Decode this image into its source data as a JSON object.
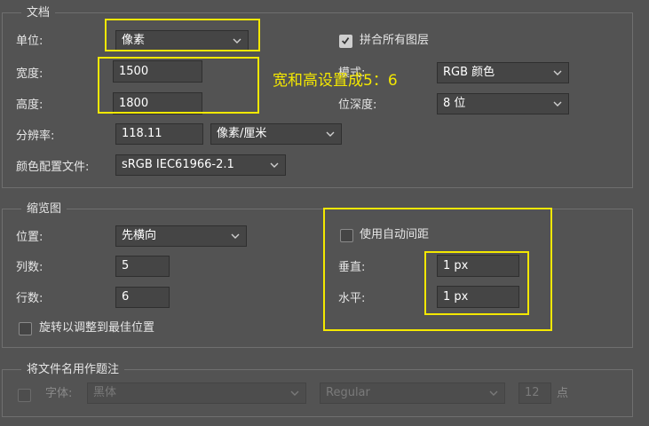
{
  "document": {
    "legend": "文档",
    "unit": {
      "label": "单位:",
      "value": "像素"
    },
    "width": {
      "label": "宽度:",
      "value": "1500"
    },
    "height": {
      "label": "高度:",
      "value": "1800"
    },
    "resolution": {
      "label": "分辨率:",
      "value": "118.11",
      "unit": "像素/厘米"
    },
    "color_profile": {
      "label": "颜色配置文件:",
      "value": "sRGB IEC61966-2.1"
    },
    "flatten": {
      "label": "拼合所有图层",
      "checked": true
    },
    "mode": {
      "label": "模式:",
      "value": "RGB 颜色"
    },
    "bit_depth": {
      "label": "位深度:",
      "value": "8 位"
    }
  },
  "annotation": {
    "text": "宽和高设置成5：6",
    "color": "#f4e800"
  },
  "thumbnail": {
    "legend": "缩览图",
    "position": {
      "label": "位置:",
      "value": "先横向"
    },
    "columns": {
      "label": "列数:",
      "value": "5"
    },
    "rows": {
      "label": "行数:",
      "value": "6"
    },
    "rotate": {
      "label": "旋转以调整到最佳位置",
      "checked": false
    },
    "auto_spacing": {
      "label": "使用自动间距",
      "checked": false
    },
    "vertical": {
      "label": "垂直:",
      "value": "1 px"
    },
    "horizontal": {
      "label": "水平:",
      "value": "1 px"
    }
  },
  "caption": {
    "legend": "将文件名用作题注",
    "checked": false,
    "font_label": "字体:",
    "font_value": "黑体",
    "style_value": "Regular",
    "size_value": "12",
    "size_unit": "点"
  }
}
